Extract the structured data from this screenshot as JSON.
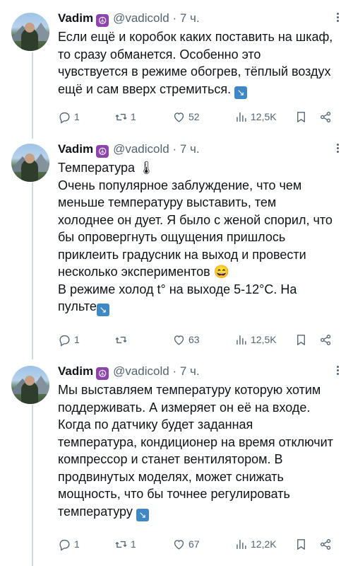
{
  "tweets": [
    {
      "name": "Vadim",
      "badge": "☮",
      "handle": "@vadicold",
      "sep": "·",
      "time": "7 ч.",
      "text": "Если ещё и коробок каких поставить на шкаф, то сразу обманется. Особенно это чувствуется в режиме обогрев, тёплый воздух ещё и сам вверх стремиться.",
      "end_emoji": "↘",
      "replies": "1",
      "retweets": "1",
      "likes": "52",
      "views": "12,5K"
    },
    {
      "name": "Vadim",
      "badge": "☮",
      "handle": "@vadicold",
      "sep": "·",
      "time": "7 ч.",
      "text": "Температура 🌡\nОчень популярное заблуждение, что чем меньше температуру выставить, тем холоднее он дует. Я было с женой спорил, что бы опровергнуть ощущения пришлось приклеить градусник на выход и провести несколько экспериментов 😄\nВ режиме холод t° на выходе 5-12°С. На пульте",
      "end_emoji": "↘",
      "replies": "1",
      "retweets": "",
      "likes": "63",
      "views": "12,5K"
    },
    {
      "name": "Vadim",
      "badge": "☮",
      "handle": "@vadicold",
      "sep": "·",
      "time": "7 ч.",
      "text": "Мы выставляем температуру которую хотим поддерживать. А измеряет он её на входе. Когда по датчику будет заданная температура, кондиционер на время отключит компрессор и станет вентилятором. В продвинутых моделях, может снижать мощность, что бы точнее регулировать температуру",
      "end_emoji": "↘",
      "replies": "1",
      "retweets": "1",
      "likes": "67",
      "views": "12,2K"
    }
  ],
  "icons": {
    "reply": "reply-icon",
    "retweet": "retweet-icon",
    "like": "heart-icon",
    "views": "views-icon",
    "bookmark": "bookmark-icon",
    "share": "share-icon"
  },
  "colors": {
    "text": "#0f1419",
    "muted": "#536471",
    "thread_line": "#cfd9de",
    "badge": "#8e44ad",
    "emoji_arrow": "#3f88c5"
  }
}
